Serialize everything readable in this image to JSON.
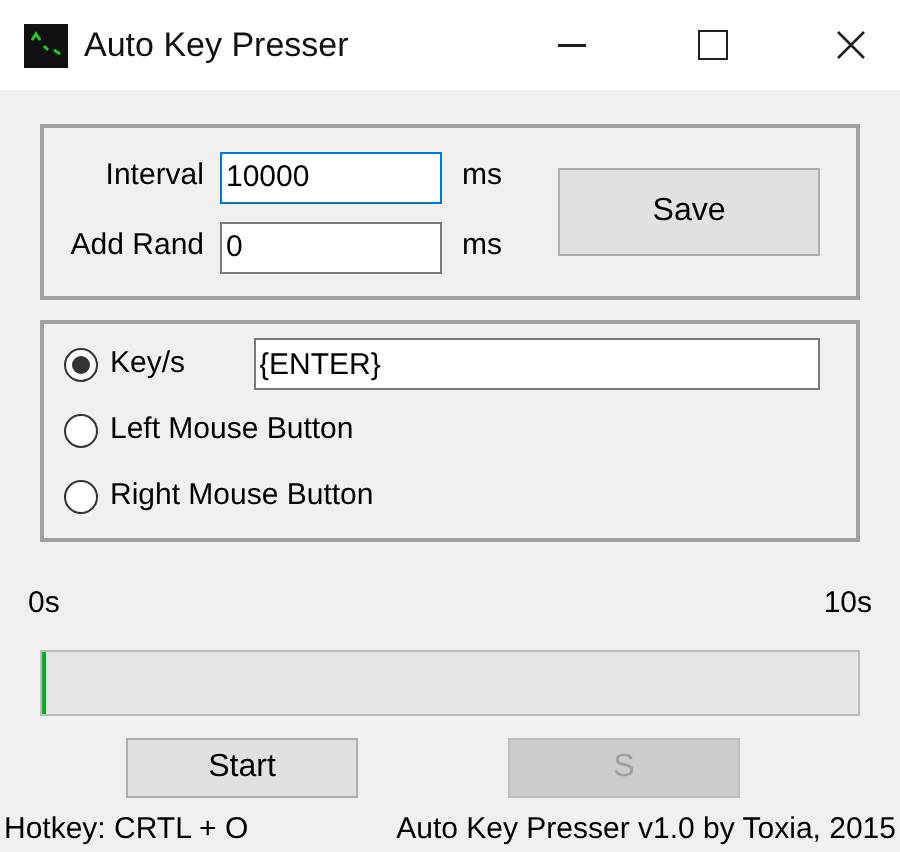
{
  "window": {
    "title": "Auto Key Presser"
  },
  "timing": {
    "fields": [
      {
        "label": "Interval",
        "value": "10000",
        "unit": "ms",
        "focused": true
      },
      {
        "label": "Add Rand",
        "value": "0",
        "unit": "ms",
        "focused": false
      }
    ],
    "save_button": "Save"
  },
  "modes": [
    {
      "label": "Key/s",
      "selected": true,
      "kind": "keys",
      "value": "{ENTER}"
    },
    {
      "label": "Left Mouse Button",
      "selected": false,
      "kind": "plain"
    },
    {
      "label": "Right Mouse Button",
      "selected": false,
      "kind": "plain"
    }
  ],
  "progress": {
    "min_label": "0s",
    "max_label": "10s",
    "level": 0
  },
  "buttons": [
    {
      "label": "Start",
      "disabled": false
    },
    {
      "label": "S",
      "disabled": true
    }
  ],
  "status_bar": {
    "hotkey": "Hotkey: CRTL + O",
    "credit": "Auto Key Presser v1.0 by Toxia, 2015"
  }
}
